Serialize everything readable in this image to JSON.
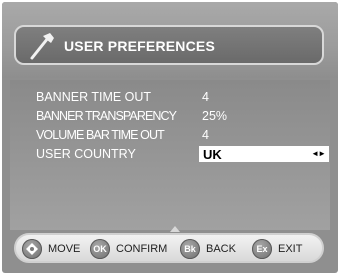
{
  "header": {
    "title": "USER PREFERENCES",
    "icon": "wrench-icon"
  },
  "settings": [
    {
      "label": "BANNER TIME OUT",
      "value": "4"
    },
    {
      "label": "BANNER TRANSPARENCY",
      "value": "25%"
    },
    {
      "label": "VOLUME BAR TIME OUT",
      "value": "4"
    },
    {
      "label": "USER COUNTRY",
      "value": "UK",
      "selector": "◄►"
    }
  ],
  "footer": {
    "move": {
      "icon_label": "",
      "label": "MOVE"
    },
    "confirm": {
      "icon_label": "OK",
      "label": "CONFIRM"
    },
    "back": {
      "icon_label": "Bk",
      "label": "BACK"
    },
    "exit": {
      "icon_label": "Ex",
      "label": "EXIT"
    }
  }
}
